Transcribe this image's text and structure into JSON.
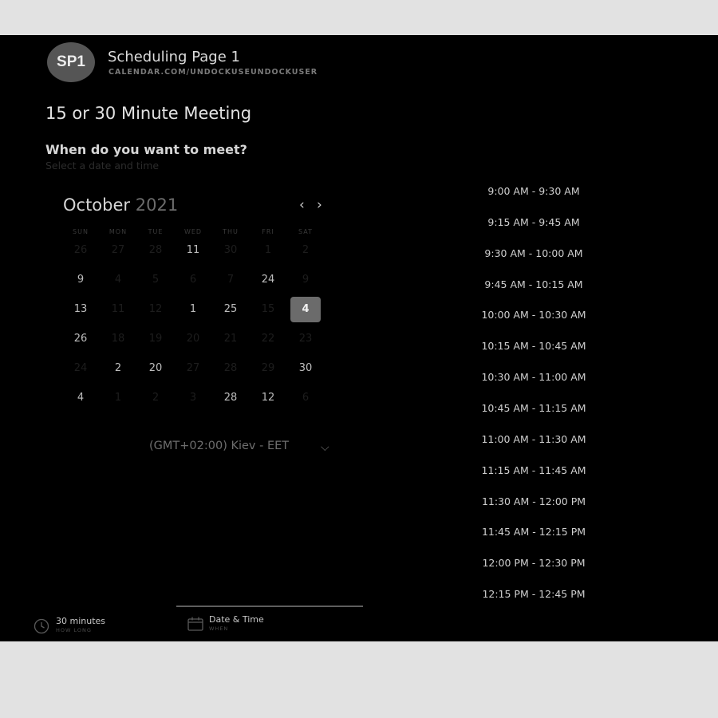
{
  "header": {
    "avatar_initials": "SP1",
    "page_name": "Scheduling Page 1",
    "page_url": "CALENDAR.COM/UNDOCKUSEUNDOCKUSER"
  },
  "meeting": {
    "title": "15 or 30 Minute Meeting",
    "prompt": "When do you want to meet?",
    "prompt_sub": "Select a date and time"
  },
  "calendar": {
    "month": "October",
    "year": "2021",
    "weekdays": [
      "SUN",
      "MON",
      "TUE",
      "WED",
      "THU",
      "FRI",
      "SAT"
    ],
    "selected_day": "4",
    "rows": [
      [
        "26",
        "27",
        "28",
        "11",
        "30",
        "1",
        "2"
      ],
      [
        "9",
        "4",
        "5",
        "6",
        "7",
        "24",
        "9"
      ],
      [
        "13",
        "11",
        "12",
        "1",
        "25",
        "15",
        "4"
      ],
      [
        "26",
        "18",
        "19",
        "20",
        "21",
        "22",
        "23"
      ],
      [
        "24",
        "2",
        "20",
        "27",
        "28",
        "29",
        "30"
      ],
      [
        "4",
        "1",
        "2",
        "3",
        "28",
        "12",
        "6"
      ]
    ],
    "dim": [
      [
        true,
        true,
        true,
        false,
        true,
        true,
        true
      ],
      [
        false,
        true,
        true,
        true,
        true,
        false,
        true
      ],
      [
        false,
        true,
        true,
        false,
        false,
        true,
        false
      ],
      [
        false,
        true,
        true,
        true,
        true,
        true,
        true
      ],
      [
        true,
        false,
        false,
        true,
        true,
        true,
        false
      ],
      [
        false,
        true,
        true,
        true,
        false,
        false,
        true
      ]
    ]
  },
  "timezone": {
    "label": "(GMT+02:00) Kiev - EET",
    "arrow": "⌵"
  },
  "time_slots": [
    "9:00 AM - 9:30 AM",
    "9:15 AM - 9:45 AM",
    "9:30 AM - 10:00 AM",
    "9:45 AM - 10:15 AM",
    "10:00 AM - 10:30 AM",
    "10:15 AM - 10:45 AM",
    "10:30 AM - 11:00 AM",
    "10:45 AM - 11:15 AM",
    "11:00 AM - 11:30 AM",
    "11:15 AM - 11:45 AM",
    "11:30 AM - 12:00 PM",
    "11:45 AM - 12:15 PM",
    "12:00 PM - 12:30 PM",
    "12:15 PM - 12:45 PM"
  ],
  "footer": {
    "duration_value": "30 minutes",
    "duration_caption": "HOW LONG",
    "datetime_value": "Date & Time",
    "datetime_caption": "WHEN"
  },
  "icons": {
    "prev": "‹",
    "next": "›"
  },
  "colors": {
    "panel_bg": "#000000",
    "selected_day_bg": "#6b6b6b",
    "page_bg": "#e2e2e2"
  }
}
